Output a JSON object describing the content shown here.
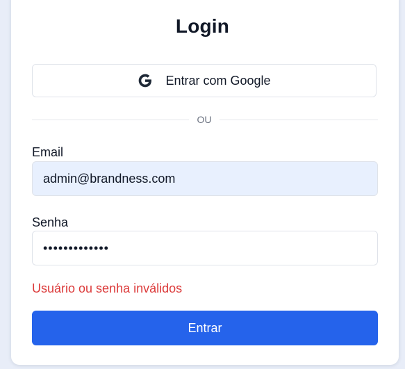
{
  "title": "Login",
  "google_button": {
    "label": "Entrar com Google",
    "icon": "google-icon"
  },
  "divider_text": "OU",
  "email": {
    "label": "Email",
    "value": "admin@brandness.com"
  },
  "password": {
    "label": "Senha",
    "value": "•••••••••••••"
  },
  "error_message": "Usuário ou senha inválidos",
  "submit_label": "Entrar",
  "colors": {
    "accent": "#2563eb",
    "error": "#dc3a3a",
    "autofill_bg": "#e8f0fe",
    "page_bg": "#e8edf8"
  }
}
